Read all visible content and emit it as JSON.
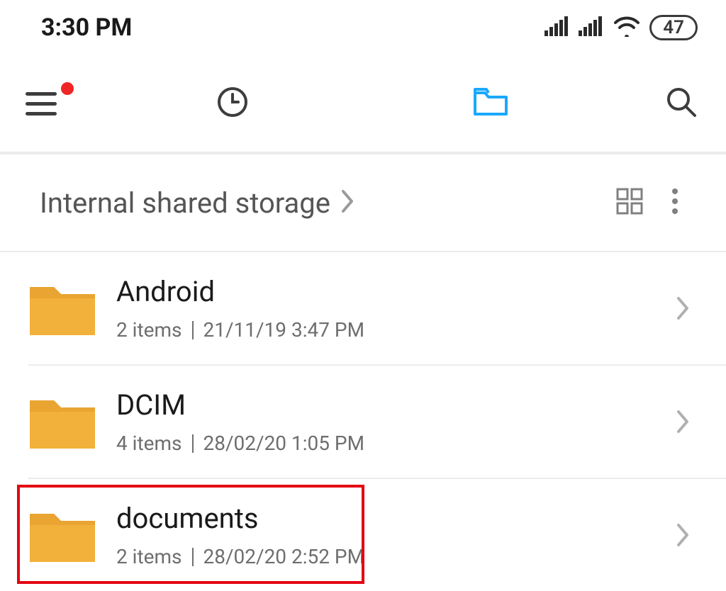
{
  "status": {
    "time": "3:30 PM",
    "battery": "47"
  },
  "breadcrumb": {
    "label": "Internal shared storage"
  },
  "folders": [
    {
      "name": "Android",
      "items": "2 items",
      "date": "21/11/19 3:47 PM"
    },
    {
      "name": "DCIM",
      "items": "4 items",
      "date": "28/02/20 1:05 PM"
    },
    {
      "name": "documents",
      "items": "2 items",
      "date": "28/02/20 2:52 PM"
    }
  ]
}
